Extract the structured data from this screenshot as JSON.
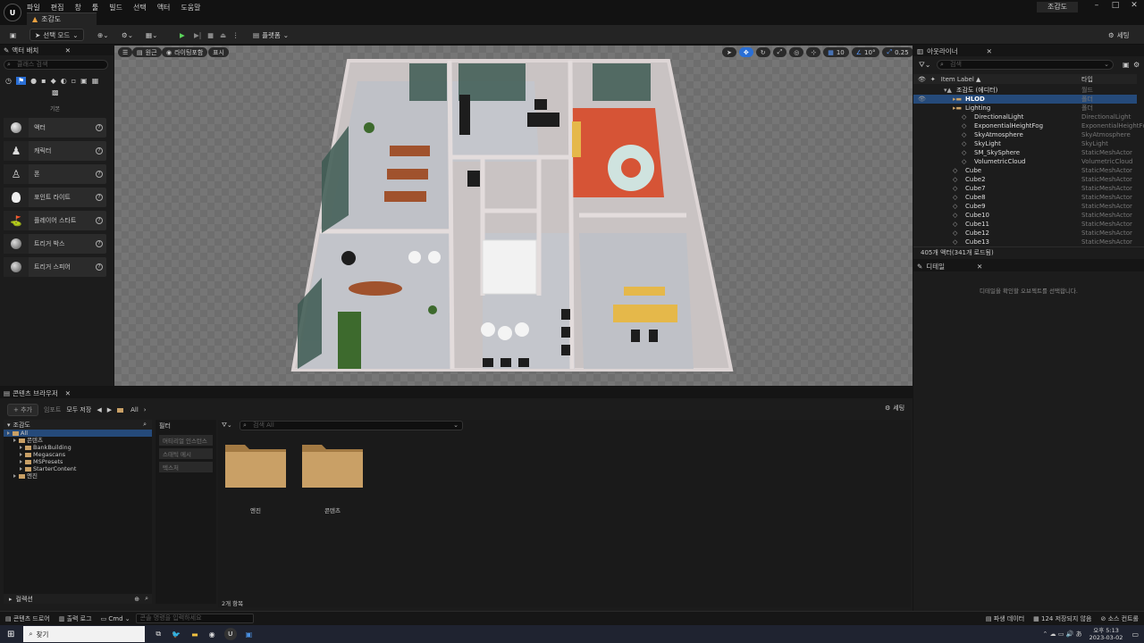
{
  "app": {
    "logo": "U",
    "menu": [
      "파일",
      "편집",
      "창",
      "툴",
      "빌드",
      "선택",
      "액터",
      "도움말"
    ],
    "level_tab": "조감도",
    "project_name": "조감도"
  },
  "window_controls": [
    "–",
    "□",
    "✕"
  ],
  "toolbar": {
    "mode_label": "선택 모드",
    "platform_label": "플랫폼",
    "settings_label": "세팅"
  },
  "place_actors": {
    "title": "액터 배치",
    "search_placeholder": "클래스 검색",
    "category_label": "기본",
    "items": [
      {
        "label": "액터",
        "icon": "sphere-icon"
      },
      {
        "label": "캐릭터",
        "icon": "character-icon"
      },
      {
        "label": "폰",
        "icon": "pawn-icon"
      },
      {
        "label": "포인트 라이트",
        "icon": "light-bulb-icon"
      },
      {
        "label": "플레이어 스타트",
        "icon": "player-start-icon"
      },
      {
        "label": "트리거 박스",
        "icon": "box-icon"
      },
      {
        "label": "트리거 스피어",
        "icon": "sphere-icon"
      }
    ]
  },
  "viewport": {
    "perspective": "원근",
    "lit": "라이팅포함",
    "show": "표시",
    "grid": "10",
    "angle": "10°",
    "scale": "0.25",
    "camera_speed": "4"
  },
  "outliner": {
    "title": "아웃라이너",
    "search_placeholder": "검색",
    "col_label": "Item Label ▲",
    "col_type": "타입",
    "rows": [
      {
        "name": "조감도 (에디터)",
        "type": "월드",
        "indent": 0
      },
      {
        "name": "HLOD",
        "type": "폴더",
        "indent": 1
      },
      {
        "name": "Lighting",
        "type": "폴더",
        "indent": 1
      },
      {
        "name": "DirectionalLight",
        "type": "DirectionalLight",
        "indent": 2
      },
      {
        "name": "ExponentialHeightFog",
        "type": "ExponentialHeightFc",
        "indent": 2
      },
      {
        "name": "SkyAtmosphere",
        "type": "SkyAtmosphere",
        "indent": 2
      },
      {
        "name": "SkyLight",
        "type": "SkyLight",
        "indent": 2
      },
      {
        "name": "SM_SkySphere",
        "type": "StaticMeshActor",
        "indent": 2
      },
      {
        "name": "VolumetricCloud",
        "type": "VolumetricCloud",
        "indent": 2
      },
      {
        "name": "Cube",
        "type": "StaticMeshActor",
        "indent": 1
      },
      {
        "name": "Cube2",
        "type": "StaticMeshActor",
        "indent": 1
      },
      {
        "name": "Cube7",
        "type": "StaticMeshActor",
        "indent": 1
      },
      {
        "name": "Cube8",
        "type": "StaticMeshActor",
        "indent": 1
      },
      {
        "name": "Cube9",
        "type": "StaticMeshActor",
        "indent": 1
      },
      {
        "name": "Cube10",
        "type": "StaticMeshActor",
        "indent": 1
      },
      {
        "name": "Cube11",
        "type": "StaticMeshActor",
        "indent": 1
      },
      {
        "name": "Cube12",
        "type": "StaticMeshActor",
        "indent": 1
      },
      {
        "name": "Cube13",
        "type": "StaticMeshActor",
        "indent": 1
      }
    ],
    "footer": "405개 액터(341개 로드됨)"
  },
  "details": {
    "title": "디테일",
    "empty_message": "디테일을 확인할 오브젝트를 선택합니다."
  },
  "content_browser": {
    "title": "콘텐츠 브라우저",
    "add": "+ 추가",
    "import": "임포트",
    "save_all": "모두 저장",
    "path": "All",
    "settings": "세팅",
    "tree_title": "조감도",
    "tree": [
      {
        "label": "All",
        "indent": 0
      },
      {
        "label": "콘텐츠",
        "indent": 1
      },
      {
        "label": "BankBuilding",
        "indent": 2
      },
      {
        "label": "Megascans",
        "indent": 2
      },
      {
        "label": "MSPresets",
        "indent": 2
      },
      {
        "label": "StarterContent",
        "indent": 2
      },
      {
        "label": "엔진",
        "indent": 1
      }
    ],
    "collections": "컬렉션",
    "filters_title": "필터",
    "filters": [
      "머티리얼 인스턴스",
      "스태틱 메시",
      "텍스처"
    ],
    "search_placeholder": "검색 All",
    "folders": [
      "엔진",
      "콘텐츠"
    ],
    "item_count": "2개 항목"
  },
  "status": {
    "drawer": "콘텐츠 드로어",
    "output": "출력 로그",
    "cmd": "Cmd",
    "console_placeholder": "콘솔 명령을 입력하세요",
    "derived": "파생 데이터",
    "unsaved": "124 저장되지 않음",
    "source": "소스 컨트롤"
  },
  "taskbar": {
    "search": "찾기",
    "time": "오후 5:13",
    "date": "2023-03-02"
  }
}
